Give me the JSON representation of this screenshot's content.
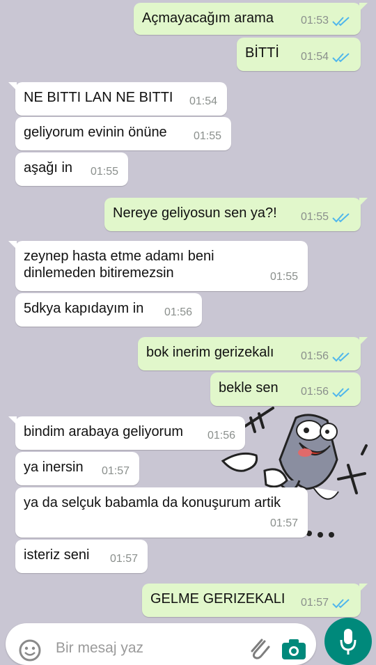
{
  "colors": {
    "outgoing_bubble": "#e1f7cb",
    "incoming_bubble": "#ffffff",
    "read_ticks": "#4fb6ec",
    "mic_button": "#00897b",
    "wallpaper": "#c9c6d3"
  },
  "messages": [
    {
      "dir": "out",
      "text": "Açmayacağım arama",
      "time": "01:53",
      "read": true
    },
    {
      "dir": "out",
      "text": "BİTTİ",
      "time": "01:54",
      "read": true
    },
    {
      "dir": "in",
      "text": "NE BITTI LAN NE BITTI",
      "time": "01:54"
    },
    {
      "dir": "in",
      "text": "geliyorum evinin önüne",
      "time": "01:55"
    },
    {
      "dir": "in",
      "text": "aşağı in",
      "time": "01:55"
    },
    {
      "dir": "out",
      "text": "Nereye geliyosun sen ya?!",
      "time": "01:55",
      "read": true
    },
    {
      "dir": "in",
      "text": "zeynep hasta etme adamı beni dinlemeden bitiremezsin",
      "time": "01:55"
    },
    {
      "dir": "in",
      "text": "5dkya kapıdayım in",
      "time": "01:56"
    },
    {
      "dir": "out",
      "text": "bok inerim gerizekalı",
      "time": "01:56",
      "read": true
    },
    {
      "dir": "out",
      "text": "bekle sen",
      "time": "01:56",
      "read": true
    },
    {
      "dir": "in",
      "text": "bindim arabaya geliyorum",
      "time": "01:56"
    },
    {
      "dir": "in",
      "text": "ya inersin",
      "time": "01:57"
    },
    {
      "dir": "in",
      "text": "ya da selçuk babamla da konuşurum artik",
      "time": "01:57"
    },
    {
      "dir": "in",
      "text": "isteriz seni",
      "time": "01:57"
    },
    {
      "dir": "out",
      "text": "GELME GERIZEKALI",
      "time": "01:57",
      "read": true
    }
  ],
  "composer": {
    "placeholder": "Bir mesaj yaz",
    "emoji_icon": "emoji-icon",
    "attach_icon": "paperclip-icon",
    "camera_icon": "camera-icon",
    "mic_icon": "mic-icon"
  }
}
